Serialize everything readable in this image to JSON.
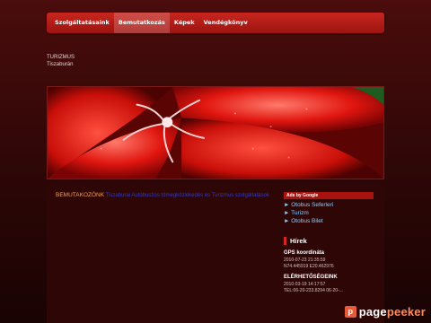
{
  "nav": {
    "items": [
      {
        "label": "Szolgáltatásaink",
        "active": false
      },
      {
        "label": "Bemutatkozás",
        "active": true
      },
      {
        "label": "Képek",
        "active": false
      },
      {
        "label": "Vendégkönyv",
        "active": false
      }
    ]
  },
  "site": {
    "title": "TURIZMUS",
    "subtitle": "Tiszaburán"
  },
  "main": {
    "lead_label": "BEMUTAKOZÓNK",
    "lead_text": "Tiszaburai Autóbuszos tömegközlekedés és Turizmus szolgáltatások"
  },
  "sidebar": {
    "ads_label": "Ads by Google",
    "links": [
      "► Otobus Seferleri",
      "► Turizm",
      "► Otobus Bilet"
    ],
    "news_heading": "Hírek",
    "news": [
      {
        "title": "GPS koordináta",
        "date": "2010-07-23 21:35:59",
        "detail": "N74.445919 E20.462976"
      },
      {
        "title": "ELÉRHETŐSÉGEINK",
        "date": "2010-03-19 14:17:57",
        "detail": "TEL:06-20-233.8294  06-20-..."
      }
    ]
  },
  "watermark": {
    "text_a": "page",
    "text_b": "peeker"
  },
  "colors": {
    "nav_bg": "#b81c16",
    "page_bg": "#3a0a0a",
    "link_color": "#3a52ff",
    "accent": "#f7a14a"
  }
}
